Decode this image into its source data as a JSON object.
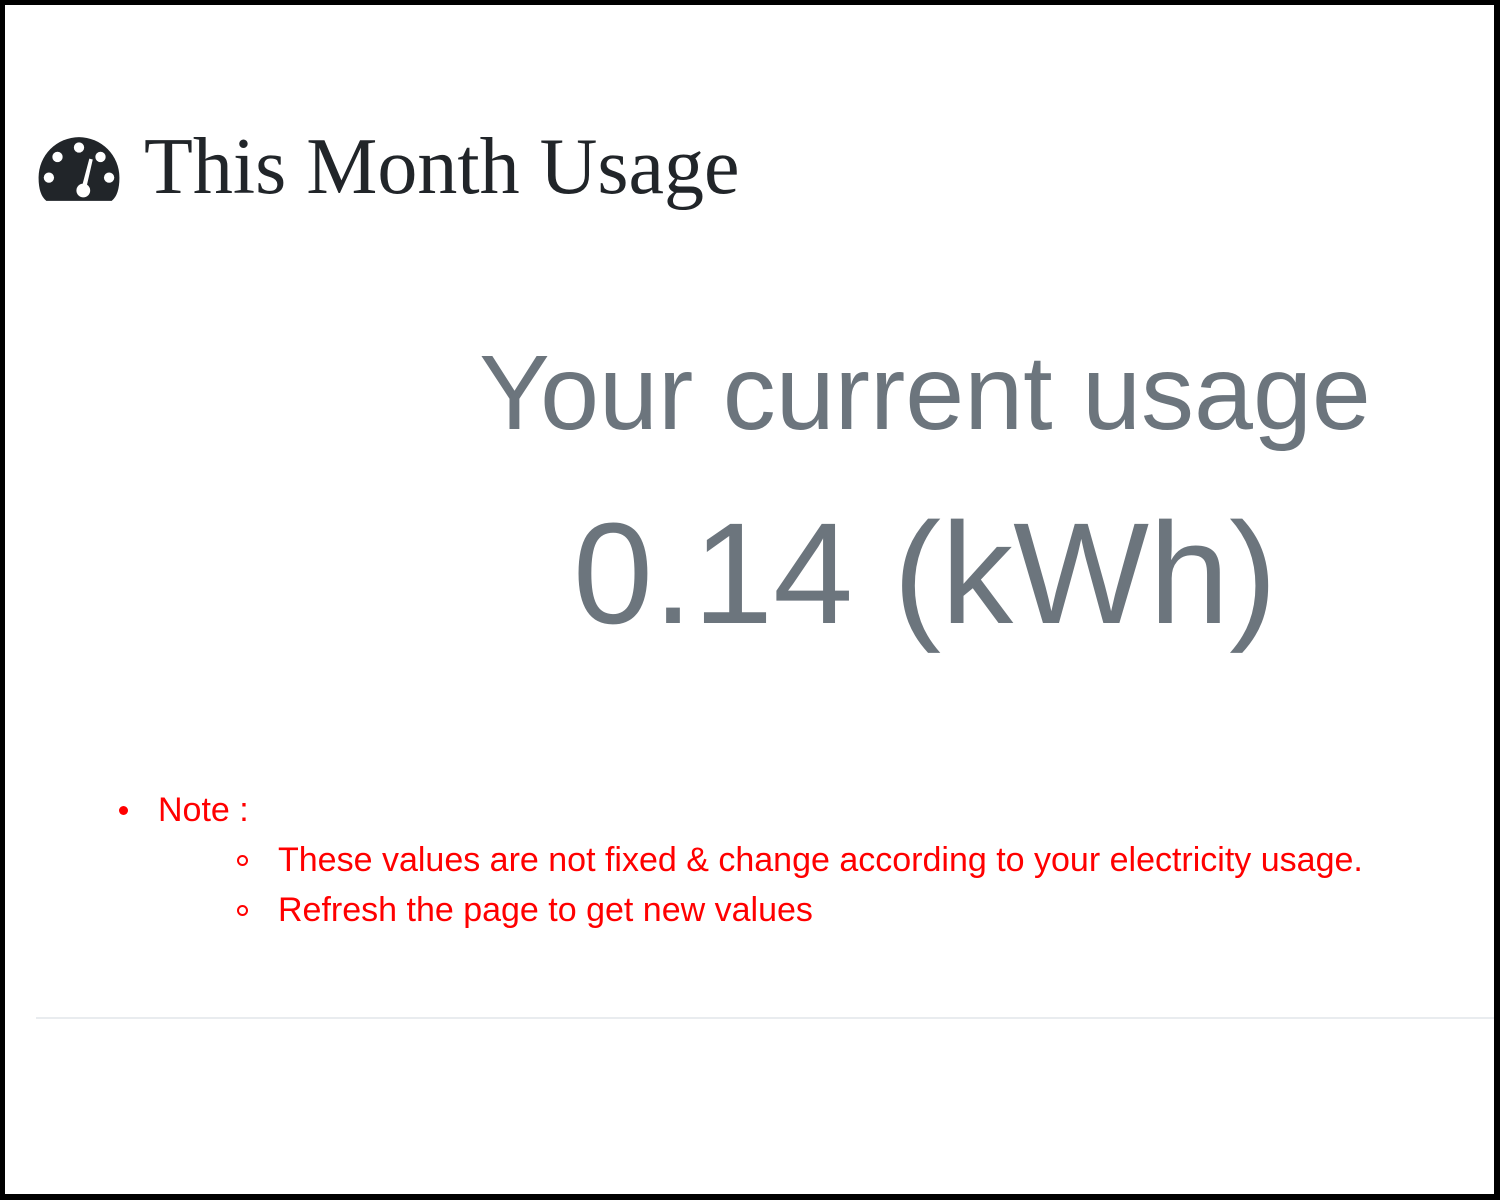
{
  "header": {
    "icon": "tachometer-gauge-icon",
    "title": "This Month Usage"
  },
  "usage": {
    "label": "Your current usage",
    "value": "0.14 (kWh)"
  },
  "notes": {
    "heading": "Note :",
    "items": [
      "These values are not fixed & change according to your electricity usage.",
      "Refresh the page to get new values"
    ]
  },
  "colors": {
    "title": "#212529",
    "muted": "#6c757d",
    "note": "#ff0000",
    "divider": "#e9ecef"
  }
}
